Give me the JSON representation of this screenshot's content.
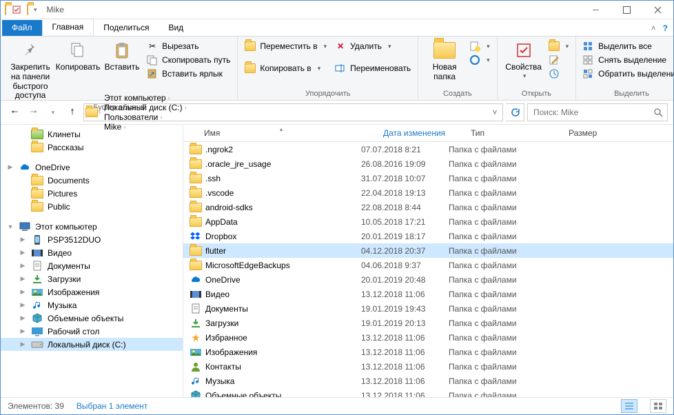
{
  "title": "Mike",
  "tabs": {
    "file": "Файл",
    "home": "Главная",
    "share": "Поделиться",
    "view": "Вид"
  },
  "ribbon": {
    "clipboard": {
      "label": "Буфер обмена",
      "pin": "Закрепить на панели\nбыстрого доступа",
      "copy": "Копировать",
      "paste": "Вставить",
      "cut": "Вырезать",
      "copypath": "Скопировать путь",
      "pastelnk": "Вставить ярлык"
    },
    "organize": {
      "label": "Упорядочить",
      "moveto": "Переместить в",
      "copyto": "Копировать в",
      "delete": "Удалить",
      "rename": "Переименовать"
    },
    "new": {
      "label": "Создать",
      "newfolder": "Новая\nпапка"
    },
    "open": {
      "label": "Открыть",
      "props": "Свойства"
    },
    "select": {
      "label": "Выделить",
      "all": "Выделить все",
      "none": "Снять выделение",
      "invert": "Обратить выделение"
    }
  },
  "breadcrumbs": [
    "Этот компьютер",
    "Локальный диск (C:)",
    "Пользователи",
    "Mike"
  ],
  "search_placeholder": "Поиск: Mike",
  "columns": {
    "name": "Имя",
    "date": "Дата изменения",
    "type": "Тип",
    "size": "Размер"
  },
  "tree": [
    {
      "icon": "folder-green",
      "label": "Клинеты",
      "indent": 1
    },
    {
      "icon": "folder",
      "label": "Рассказы",
      "indent": 1
    },
    {
      "sep": true
    },
    {
      "icon": "onedrive",
      "label": "OneDrive",
      "indent": 0,
      "exp": "▶"
    },
    {
      "icon": "folder",
      "label": "Documents",
      "indent": 1
    },
    {
      "icon": "folder",
      "label": "Pictures",
      "indent": 1
    },
    {
      "icon": "folder",
      "label": "Public",
      "indent": 1
    },
    {
      "sep": true
    },
    {
      "icon": "pc",
      "label": "Этот компьютер",
      "indent": 0,
      "exp": "▼"
    },
    {
      "icon": "phone",
      "label": "PSP3512DUO",
      "indent": 1,
      "exp": "▶"
    },
    {
      "icon": "video",
      "label": "Видео",
      "indent": 1,
      "exp": "▶"
    },
    {
      "icon": "docs",
      "label": "Документы",
      "indent": 1,
      "exp": "▶"
    },
    {
      "icon": "downloads",
      "label": "Загрузки",
      "indent": 1,
      "exp": "▶"
    },
    {
      "icon": "pictures",
      "label": "Изображения",
      "indent": 1,
      "exp": "▶"
    },
    {
      "icon": "music",
      "label": "Музыка",
      "indent": 1,
      "exp": "▶"
    },
    {
      "icon": "3d",
      "label": "Объемные объекты",
      "indent": 1,
      "exp": "▶"
    },
    {
      "icon": "desktop",
      "label": "Рабочий стол",
      "indent": 1,
      "exp": "▶"
    },
    {
      "icon": "disk",
      "label": "Локальный диск (C:)",
      "indent": 1,
      "exp": "▶",
      "sel": true
    }
  ],
  "rows": [
    {
      "icon": "folder",
      "name": ".ngrok2",
      "date": "07.07.2018 8:21",
      "type": "Папка с файлами"
    },
    {
      "icon": "folder",
      "name": ".oracle_jre_usage",
      "date": "26.08.2016 19:09",
      "type": "Папка с файлами"
    },
    {
      "icon": "folder",
      "name": ".ssh",
      "date": "31.07.2018 10:07",
      "type": "Папка с файлами"
    },
    {
      "icon": "folder",
      "name": ".vscode",
      "date": "22.04.2018 19:13",
      "type": "Папка с файлами"
    },
    {
      "icon": "folder",
      "name": "android-sdks",
      "date": "22.08.2018 8:44",
      "type": "Папка с файлами"
    },
    {
      "icon": "folder",
      "name": "AppData",
      "date": "10.05.2018 17:21",
      "type": "Папка с файлами"
    },
    {
      "icon": "dropbox",
      "name": "Dropbox",
      "date": "20.01.2019 18:17",
      "type": "Папка с файлами"
    },
    {
      "icon": "folder",
      "name": "flutter",
      "date": "04.12.2018 20:37",
      "type": "Папка с файлами",
      "sel": true
    },
    {
      "icon": "folder",
      "name": "MicrosoftEdgeBackups",
      "date": "04.06.2018 9:37",
      "type": "Папка с файлами"
    },
    {
      "icon": "onedrive",
      "name": "OneDrive",
      "date": "20.01.2019 20:48",
      "type": "Папка с файлами"
    },
    {
      "icon": "video",
      "name": "Видео",
      "date": "13.12.2018 11:06",
      "type": "Папка с файлами"
    },
    {
      "icon": "docs",
      "name": "Документы",
      "date": "19.01.2019 19:43",
      "type": "Папка с файлами"
    },
    {
      "icon": "downloads",
      "name": "Загрузки",
      "date": "19.01.2019 20:13",
      "type": "Папка с файлами"
    },
    {
      "icon": "star",
      "name": "Избранное",
      "date": "13.12.2018 11:06",
      "type": "Папка с файлами"
    },
    {
      "icon": "pictures",
      "name": "Изображения",
      "date": "13.12.2018 11:06",
      "type": "Папка с файлами"
    },
    {
      "icon": "contacts",
      "name": "Контакты",
      "date": "13.12.2018 11:06",
      "type": "Папка с файлами"
    },
    {
      "icon": "music",
      "name": "Музыка",
      "date": "13.12.2018 11:06",
      "type": "Папка с файлами"
    },
    {
      "icon": "3d",
      "name": "Объемные объекты",
      "date": "13.12.2018 11:06",
      "type": "Папка с файлами"
    }
  ],
  "status": {
    "count": "Элементов: 39",
    "selected": "Выбран 1 элемент"
  }
}
